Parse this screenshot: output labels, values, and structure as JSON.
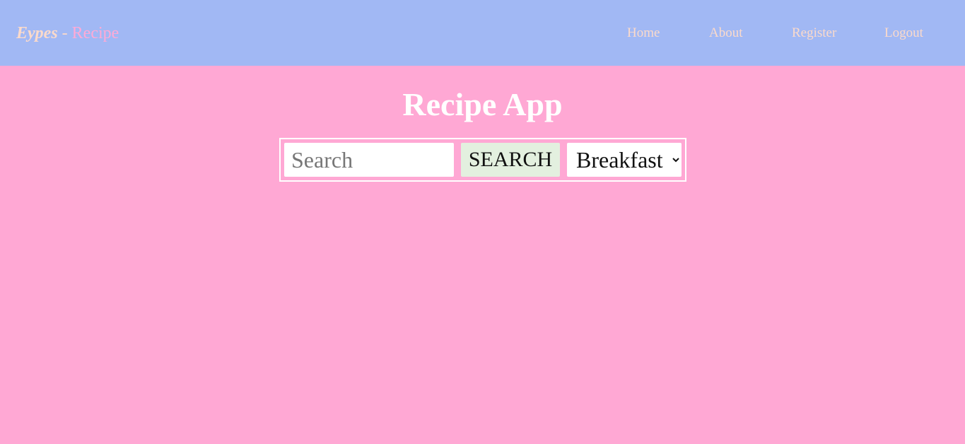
{
  "header": {
    "brand_name": "Eypes",
    "brand_separator": " - ",
    "brand_subtitle": "Recipe",
    "nav": {
      "home": "Home",
      "about": "About",
      "register": "Register",
      "logout": "Logout"
    }
  },
  "main": {
    "title": "Recipe App",
    "search": {
      "placeholder": "Search",
      "value": "",
      "button_label": "SEARCH",
      "category_selected": "Breakfast"
    }
  },
  "colors": {
    "navbar_bg": "#a1b8f4",
    "page_bg": "#ffa8d4",
    "brand_accent": "#ffaad6",
    "nav_text": "#fbdacb",
    "search_button_bg": "#e3f0df"
  }
}
